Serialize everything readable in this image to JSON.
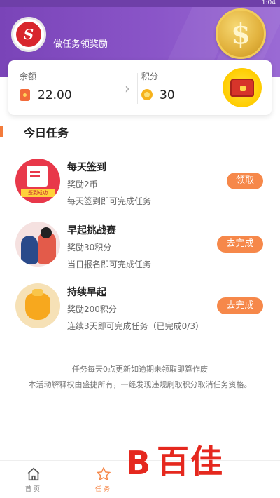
{
  "status": {
    "time": "1:04"
  },
  "header": {
    "title": "做任务领奖励",
    "coin_symbol": "$"
  },
  "balance": {
    "label": "余额",
    "value": "22.00",
    "points_label": "积分",
    "points_value": "30"
  },
  "section": {
    "title": "今日任务"
  },
  "tasks": [
    {
      "title": "每天签到",
      "reward": "奖励2币",
      "desc": "每天签到即可完成任务",
      "button": "领取",
      "image_tag": "签到成功"
    },
    {
      "title": "早起挑战赛",
      "reward": "奖励30积分",
      "desc": "当日报名即可完成任务",
      "button": "去完成"
    },
    {
      "title": "持续早起",
      "reward": "奖励200积分",
      "desc": "连续3天即可完成任务（已完成0/3）",
      "button": "去完成"
    }
  ],
  "footnotes": [
    "任务每天0点更新如逾期未领取即算作废",
    "本活动解释权由盛捷所有，一经发现违规刷取积分取消任务资格。"
  ],
  "nav": [
    {
      "label": "首页",
      "icon": "home-icon"
    },
    {
      "label": "任务",
      "icon": "star-icon"
    }
  ],
  "watermark": {
    "letter": "B",
    "text": "百佳"
  },
  "colors": {
    "accent": "#f6884a",
    "header": "#7a44b8",
    "section_bar": "#f37b3b"
  }
}
